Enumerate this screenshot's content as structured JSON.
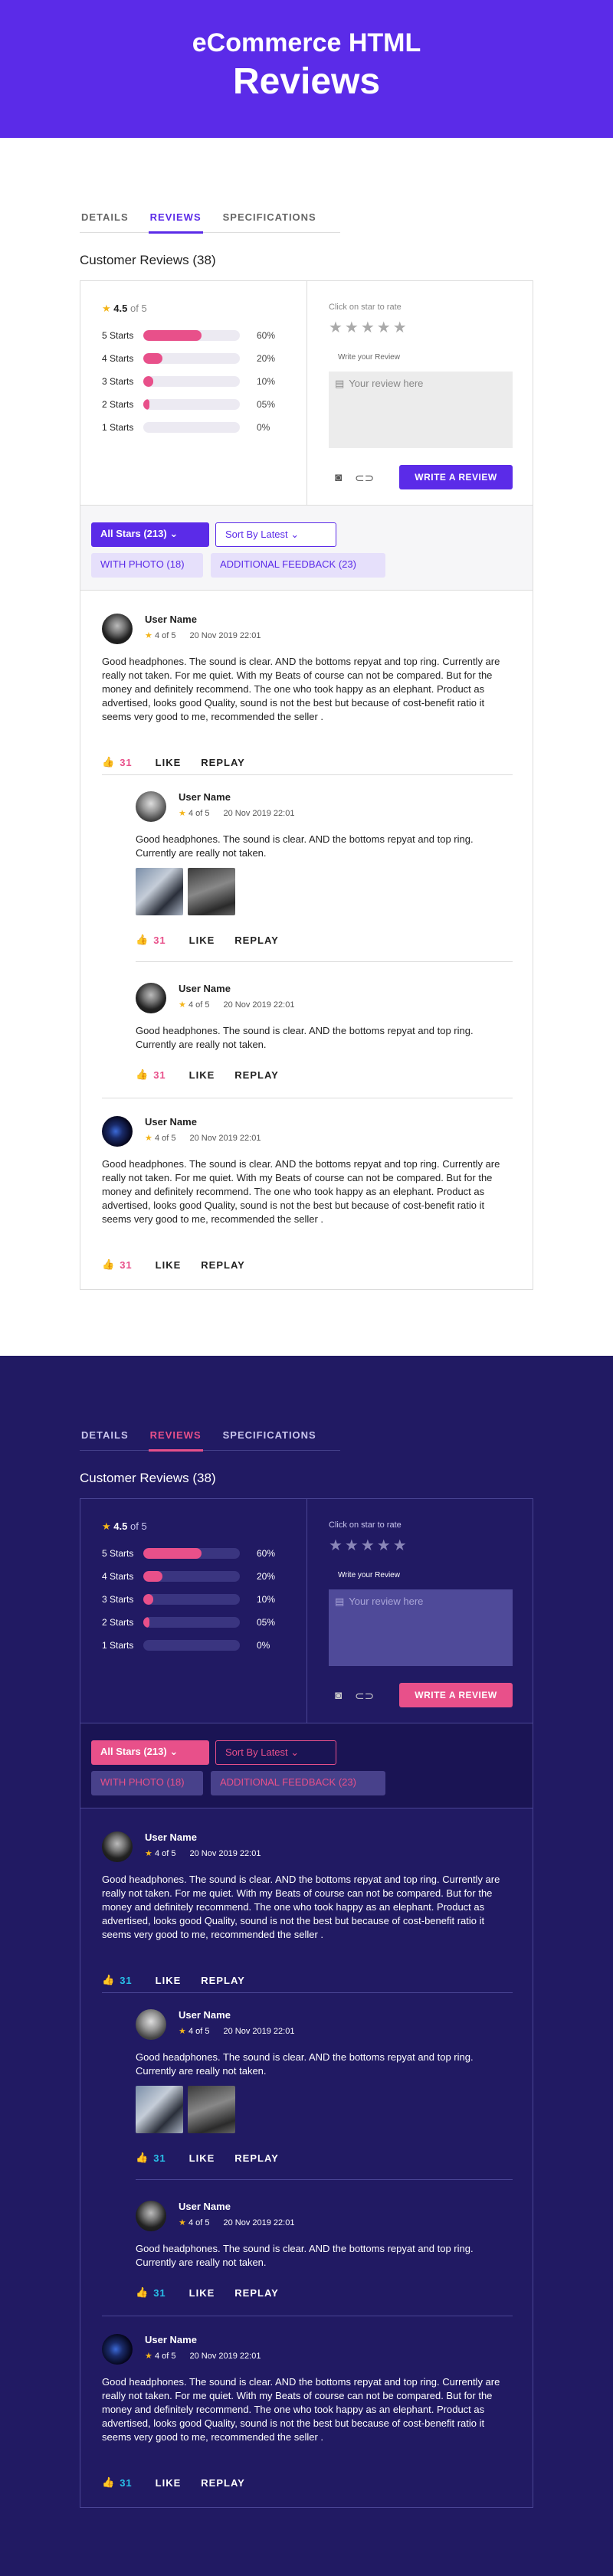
{
  "hero": {
    "line1": "eCommerce HTML",
    "line2": "Reviews"
  },
  "tabs": [
    {
      "label": "DETAILS"
    },
    {
      "label": "REVIEWS"
    },
    {
      "label": "SPECIFICATIONS"
    }
  ],
  "customer_reviews_title": "Customer Reviews (38)",
  "summary": {
    "average": "4.5",
    "of": "of 5",
    "bars": [
      {
        "label": "5 Starts",
        "pct": "60%",
        "fill": 0.6
      },
      {
        "label": "4 Starts",
        "pct": "20%",
        "fill": 0.2
      },
      {
        "label": "3 Starts",
        "pct": "10%",
        "fill": 0.1
      },
      {
        "label": "2 Starts",
        "pct": "05%",
        "fill": 0.05
      },
      {
        "label": "1 Starts",
        "pct": "0%",
        "fill": 0
      }
    ]
  },
  "writer": {
    "click_hint": "Click on star to rate",
    "empty_stars": "★★★★★",
    "label": "Write your Review",
    "placeholder": "Your review here",
    "button": "WRITE A REVIEW"
  },
  "filters": {
    "all": "All Stars (213)",
    "sort": "Sort By Latest",
    "photo": "WITH PHOTO (18)",
    "feedback": "ADDITIONAL FEEDBACK (23)"
  },
  "reviews": [
    {
      "user": "User Name",
      "rating": "4 of 5",
      "date": "20 Nov 2019 22:01",
      "text": "Good headphones. The sound is clear. AND the bottoms repyat and top ring. Currently are really not taken. For me quiet. With my Beats of course can not be compared. But for the money and definitely recommend. The one who took happy as an elephant. Product as advertised, looks good Quality, sound is not the best but because of cost-benefit ratio it seems very good to me, recommended the seller .",
      "count": "31"
    },
    {
      "user": "User Name",
      "rating": "4 of 5",
      "date": "20 Nov 2019 22:01",
      "text": "Good headphones. The sound is clear. AND the bottoms repyat and top ring. Currently are really not taken.",
      "count": "31"
    },
    {
      "user": "User Name",
      "rating": "4 of 5",
      "date": "20 Nov 2019 22:01",
      "text": "Good headphones. The sound is clear. AND the bottoms repyat and top ring. Currently are really not taken.",
      "count": "31"
    },
    {
      "user": "User Name",
      "rating": "4 of 5",
      "date": "20 Nov 2019 22:01",
      "text": "Good headphones. The sound is clear. AND the bottoms repyat and top ring. Currently are really not taken. For me quiet. With my Beats of course can not be compared. But for the money and definitely recommend. The one who took happy as an elephant. Product as advertised, looks good Quality, sound is not the best but because of cost-benefit ratio it seems very good to me, recommended the seller .",
      "count": "31"
    }
  ],
  "actions": {
    "like": "LIKE",
    "replay": "REPLAY"
  },
  "colors": {
    "brand_purple": "#5b2be8",
    "accent_pink": "#e8508a",
    "dark_bg": "#211a63",
    "thumb_cyan": "#28c0e8",
    "star_gold": "#f4b51a"
  }
}
